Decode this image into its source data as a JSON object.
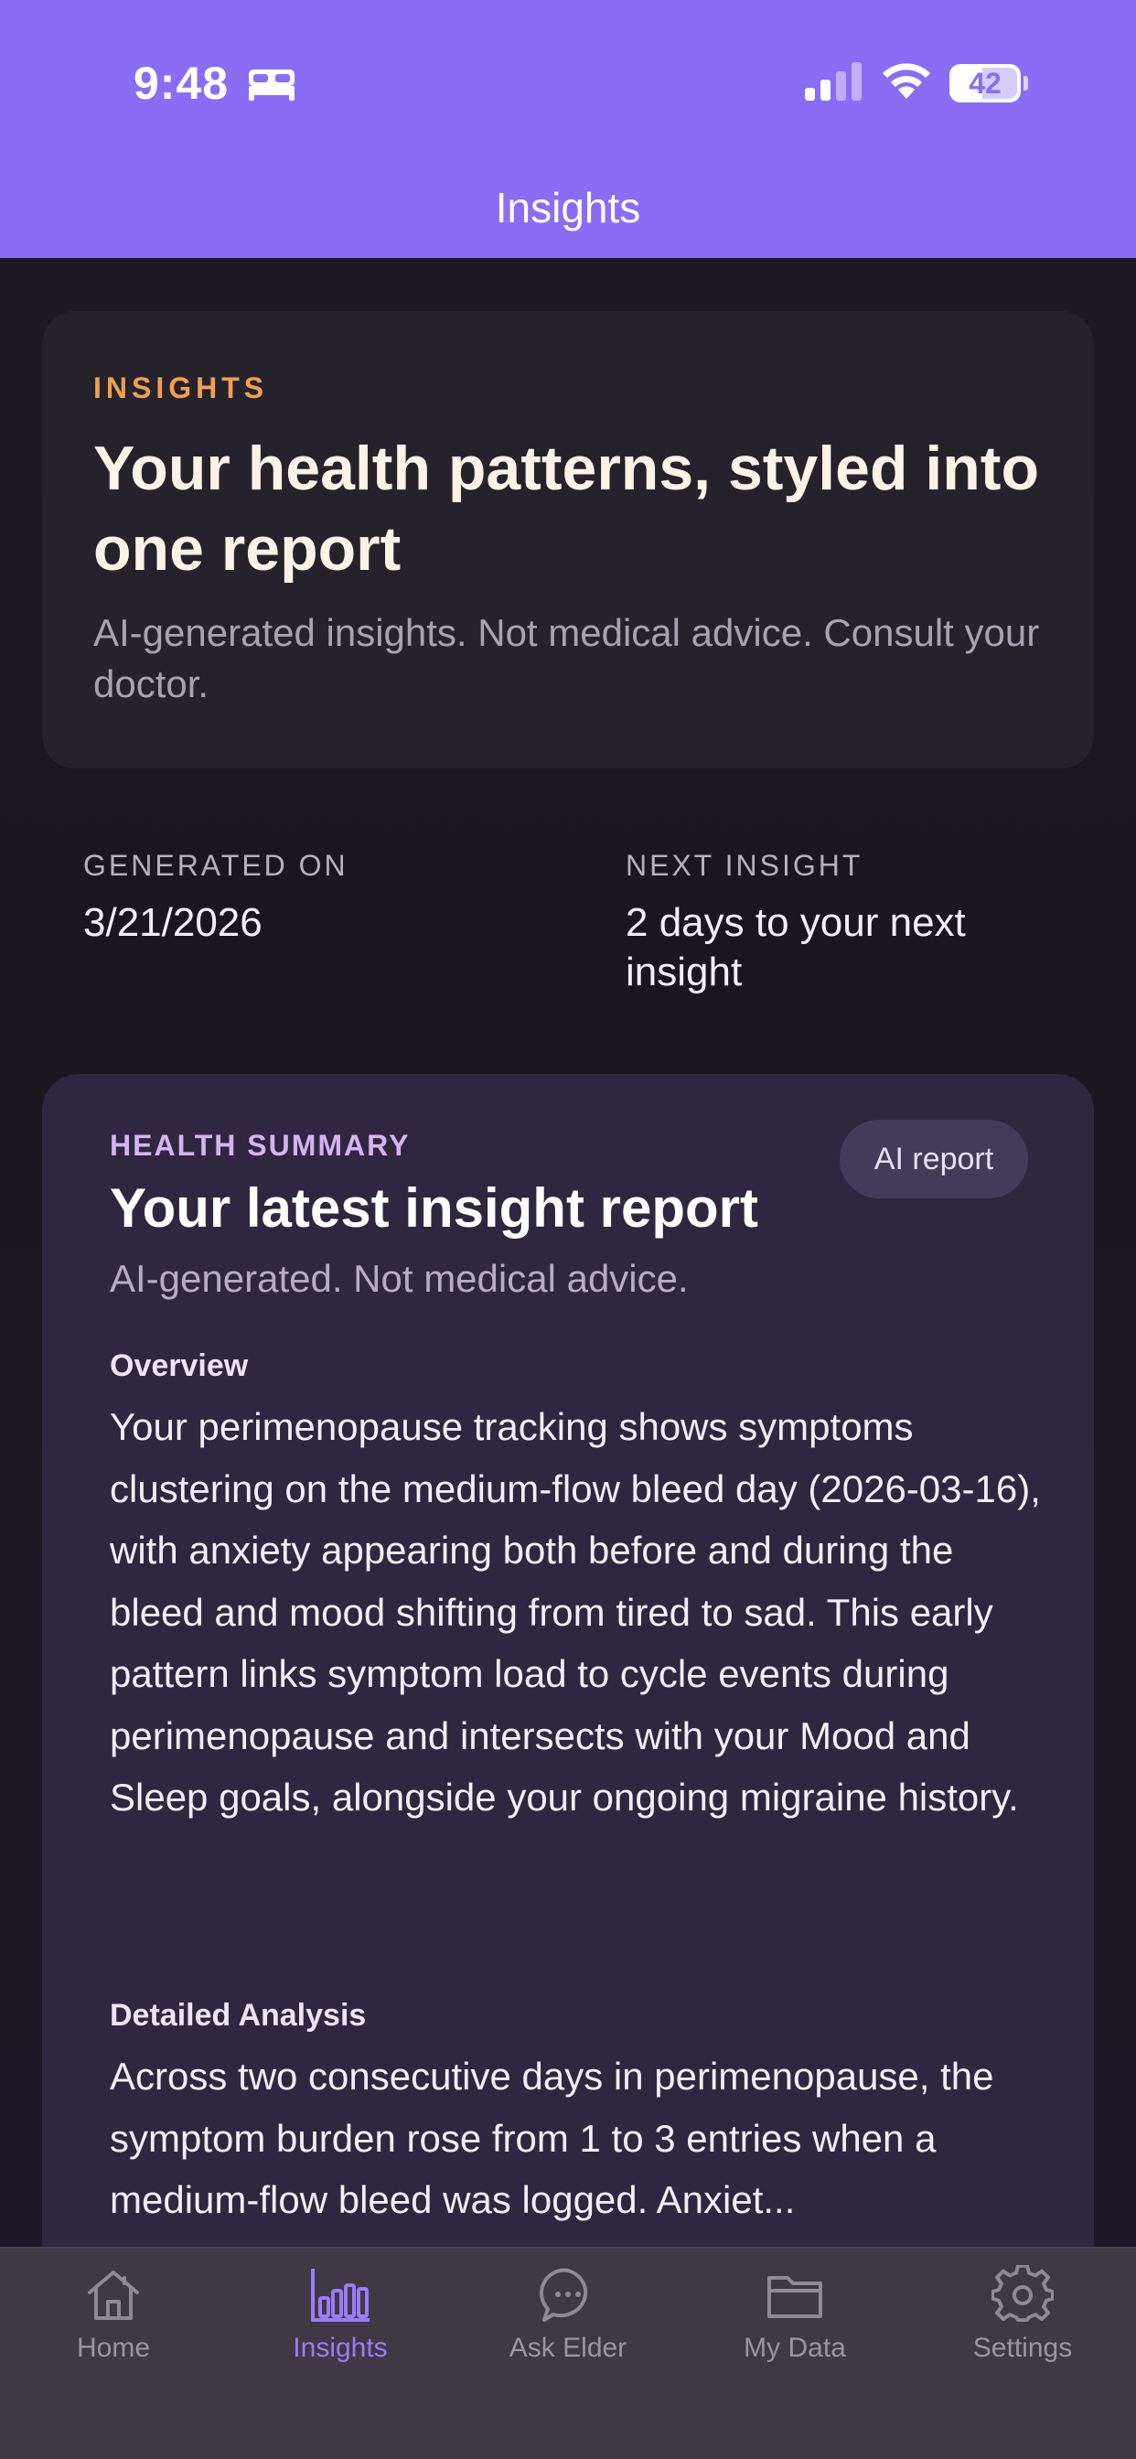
{
  "status_bar": {
    "time": "9:48",
    "battery": "42",
    "icons": [
      "bed-icon",
      "signal-icon",
      "wifi-icon",
      "battery-icon"
    ]
  },
  "header": {
    "title": "Insights"
  },
  "intro": {
    "eyebrow": "INSIGHTS",
    "title": "Your health patterns, styled into one report",
    "subtitle": "AI-generated insights. Not medical advice. Consult your doctor."
  },
  "meta": {
    "generated_label": "GENERATED ON",
    "generated_value": "3/21/2026",
    "next_label": "NEXT INSIGHT",
    "next_value": "2 days to your next insight"
  },
  "summary": {
    "eyebrow": "HEALTH SUMMARY",
    "badge": "AI report",
    "title": "Your latest insight report",
    "subtitle": "AI-generated. Not medical advice.",
    "overview_heading": "Overview",
    "overview_text": "Your perimenopause tracking shows symptoms clustering on the medium-flow bleed day (2026-03-16), with anxiety appearing both before and during the bleed and mood shifting from tired to sad. This early pattern links symptom load to cycle events during perimenopause and intersects with your Mood and Sleep goals, alongside your ongoing migraine history.",
    "analysis_heading": "Detailed Analysis",
    "analysis_text": "Across two consecutive days in perimenopause, the symptom burden rose from 1 to 3 entries when a medium-flow bleed was logged. Anxiet..."
  },
  "tabs": [
    {
      "label": "Home",
      "icon": "home-icon",
      "active": false
    },
    {
      "label": "Insights",
      "icon": "bar-chart-icon",
      "active": true
    },
    {
      "label": "Ask Elder",
      "icon": "chat-bubble-icon",
      "active": false
    },
    {
      "label": "My Data",
      "icon": "folder-icon",
      "active": false
    },
    {
      "label": "Settings",
      "icon": "gear-icon",
      "active": false
    }
  ],
  "colors": {
    "header": "#8a6df5",
    "accent_orange": "#f0a04e",
    "accent_lavender": "#d7b3f2",
    "tab_active": "#9a7cf6"
  }
}
